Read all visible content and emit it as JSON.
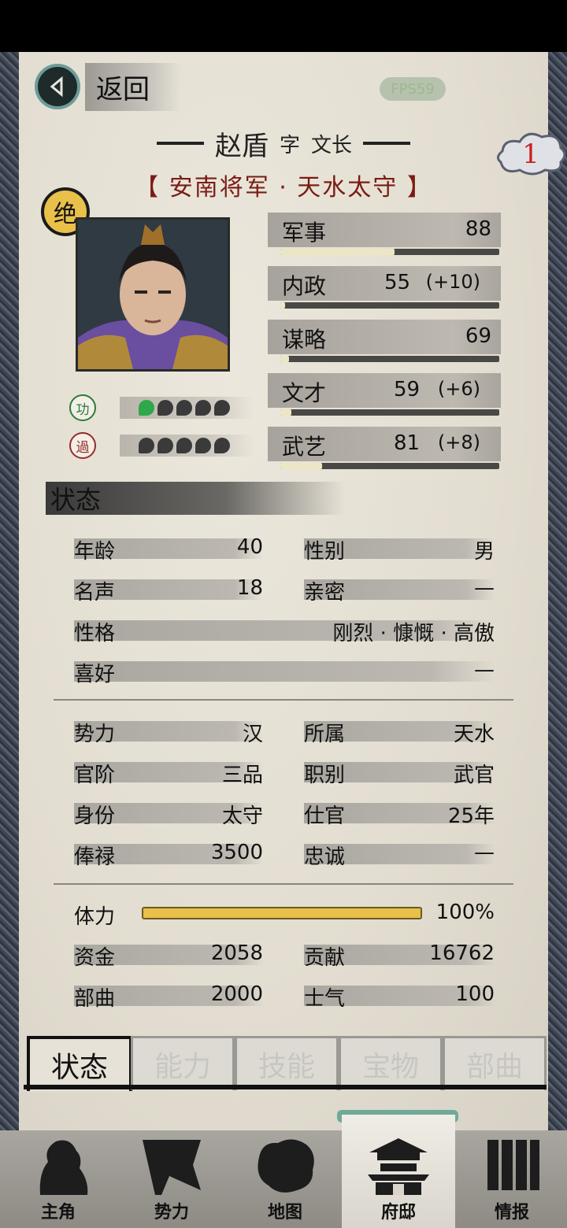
{
  "header": {
    "back_label": "返回",
    "fps": "FPS59"
  },
  "officer": {
    "name": "赵盾",
    "zi_label": "字",
    "courtesy_name": "文长",
    "titles": "【 安南将军 · 天水太守 】",
    "rank_badge": "1",
    "tier_badge": "绝",
    "merit_label": "功",
    "fault_label": "過",
    "merit_level": 1,
    "fault_level": 0
  },
  "attributes": [
    {
      "name": "军事",
      "value": "88",
      "bonus": "",
      "progress": 0.52
    },
    {
      "name": "内政",
      "value": "55",
      "bonus": "(+10)",
      "progress": 0.02
    },
    {
      "name": "谋略",
      "value": "69",
      "bonus": "",
      "progress": 0.04
    },
    {
      "name": "文才",
      "value": "59",
      "bonus": "(+6)",
      "progress": 0.05
    },
    {
      "name": "武艺",
      "value": "81",
      "bonus": "(+8)",
      "progress": 0.19
    }
  ],
  "status": {
    "title": "状态",
    "age_label": "年龄",
    "age": "40",
    "gender_label": "性别",
    "gender": "男",
    "fame_label": "名声",
    "fame": "18",
    "intimacy_label": "亲密",
    "intimacy": "—",
    "personality_label": "性格",
    "personality": "刚烈 · 慷慨 · 高傲",
    "hobby_label": "喜好",
    "hobby": "—",
    "faction_label": "势力",
    "faction": "汉",
    "belong_label": "所属",
    "belong": "天水",
    "rank_label": "官阶",
    "rank": "三品",
    "post_label": "职别",
    "post": "武官",
    "identity_label": "身份",
    "identity": "太守",
    "service_label": "仕官",
    "service": "25年",
    "salary_label": "俸禄",
    "salary": "3500",
    "loyalty_label": "忠诚",
    "loyalty": "—",
    "stamina_label": "体力",
    "stamina": "100%",
    "stamina_ratio": 1.0,
    "funds_label": "资金",
    "funds": "2058",
    "contribution_label": "贡献",
    "contribution": "16762",
    "troops_label": "部曲",
    "troops": "2000",
    "morale_label": "士气",
    "morale": "100"
  },
  "tabs": [
    "状态",
    "能力",
    "技能",
    "宝物",
    "部曲"
  ],
  "nav": [
    "主角",
    "势力",
    "地图",
    "府邸",
    "情报"
  ],
  "colors": {
    "paper": "#e5e1d6",
    "title_red": "#7a1c14",
    "stamina": "#e8c04a",
    "bar_fill": "#ece6c4"
  }
}
